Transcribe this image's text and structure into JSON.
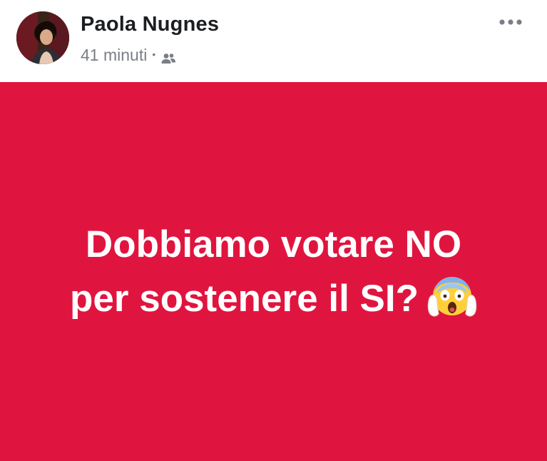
{
  "post": {
    "author": "Paola Nugnes",
    "timestamp": "41 minuti",
    "separator": "•",
    "audience_icon": "friends-icon",
    "more_icon": "more-options-icon"
  },
  "banner": {
    "background_color": "#e0153f",
    "text_color": "#ffffff",
    "line1": "Dobbiamo votare NO",
    "line2": "per sostenere il SI?",
    "emoji": "face-screaming-in-fear-icon"
  }
}
